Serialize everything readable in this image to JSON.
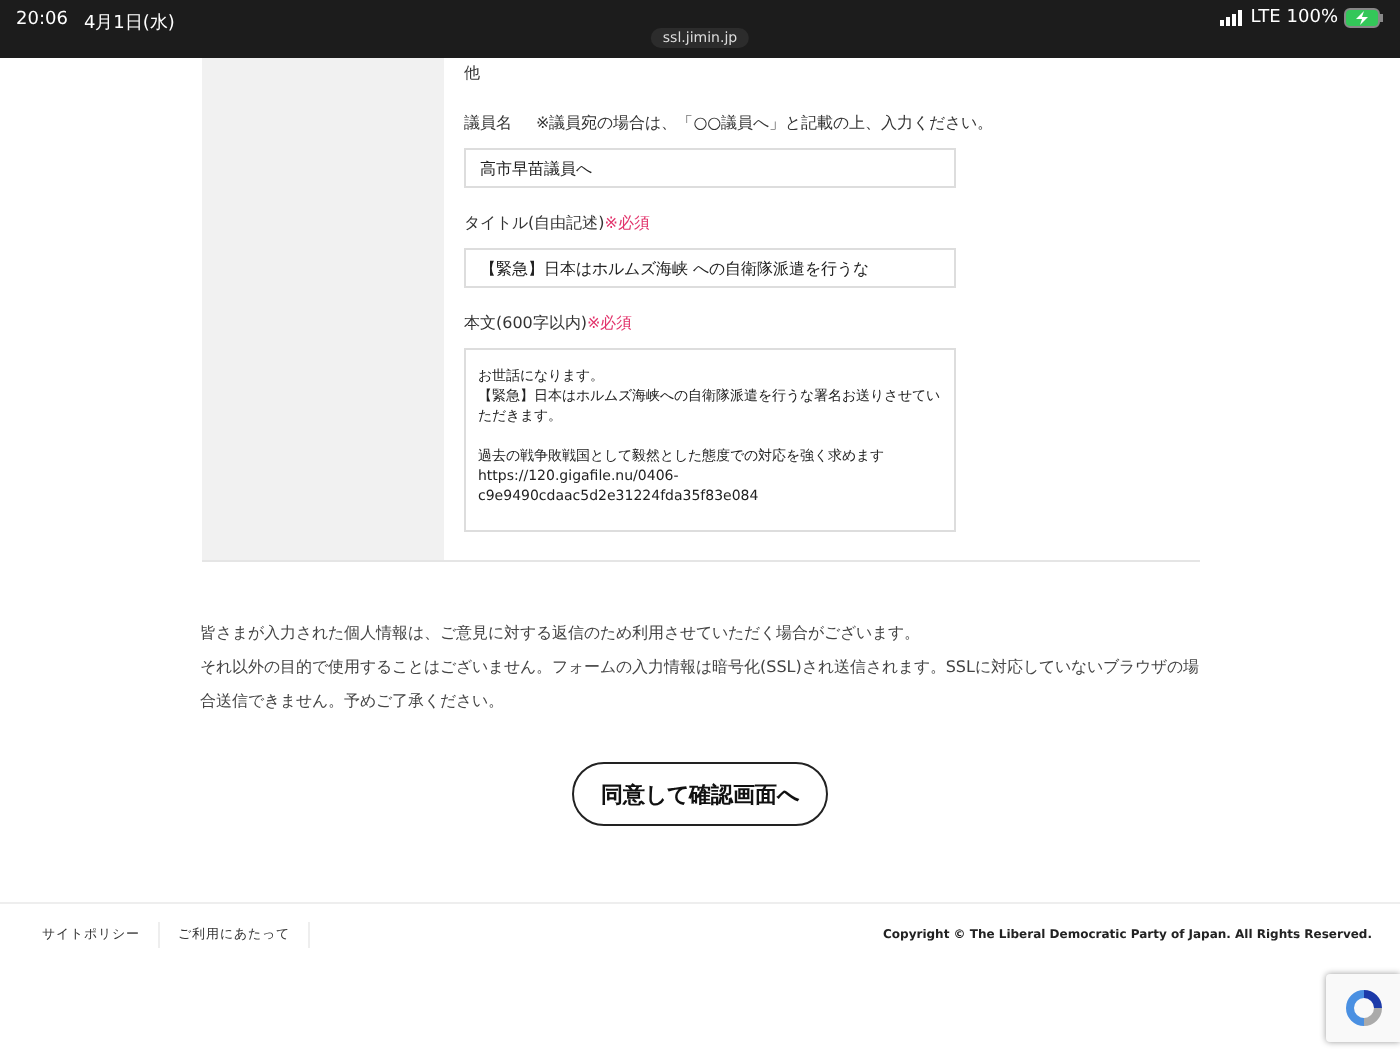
{
  "status_bar": {
    "time": "20:06",
    "date": "4月1日(水)",
    "url": "ssl.jimin.jp",
    "network": "LTE",
    "battery": "100%",
    "charging": true
  },
  "form": {
    "prev_text": "他",
    "fields": [
      {
        "kind": "input",
        "label": "議員名",
        "note": "※議員宛の場合は、「○○議員へ」と記載の上、入力ください。",
        "value": "高市早苗議員へ"
      },
      {
        "kind": "input",
        "label": "タイトル(自由記述)",
        "required": "※必須",
        "value": "【緊急】日本はホルムズ海峡 への自衛隊派遣を行うな"
      },
      {
        "kind": "textarea",
        "label": "本文(600字以内)",
        "required": "※必須",
        "paragraphs": [
          [
            "お世話になります。",
            "【緊急】日本はホルムズ海峡への自衛隊派遣を行うな署名お送りさせていただきます。"
          ],
          [
            "過去の戦争敗戦国として毅然とした態度での対応を強く求めます",
            "https://120.gigafile.nu/0406-c9e9490cdaac5d2e31224fda35f83e084"
          ]
        ]
      }
    ]
  },
  "notice": [
    "皆さまが入力された個人情報は、ご意見に対する返信のため利用させていただく場合がございます。",
    "それ以外の目的で使用することはございません。フォームの入力情報は暗号化(SSL)され送信されます。SSLに対応していないブラウザの場合送信できません。予めご了承ください。"
  ],
  "submit_button": "同意して確認画面へ",
  "footer": {
    "links": [
      "サイトポリシー",
      "ご利用にあたって"
    ],
    "copyright": "Copyright © The Liberal Democratic Party of Japan. All Rights Reserved."
  }
}
